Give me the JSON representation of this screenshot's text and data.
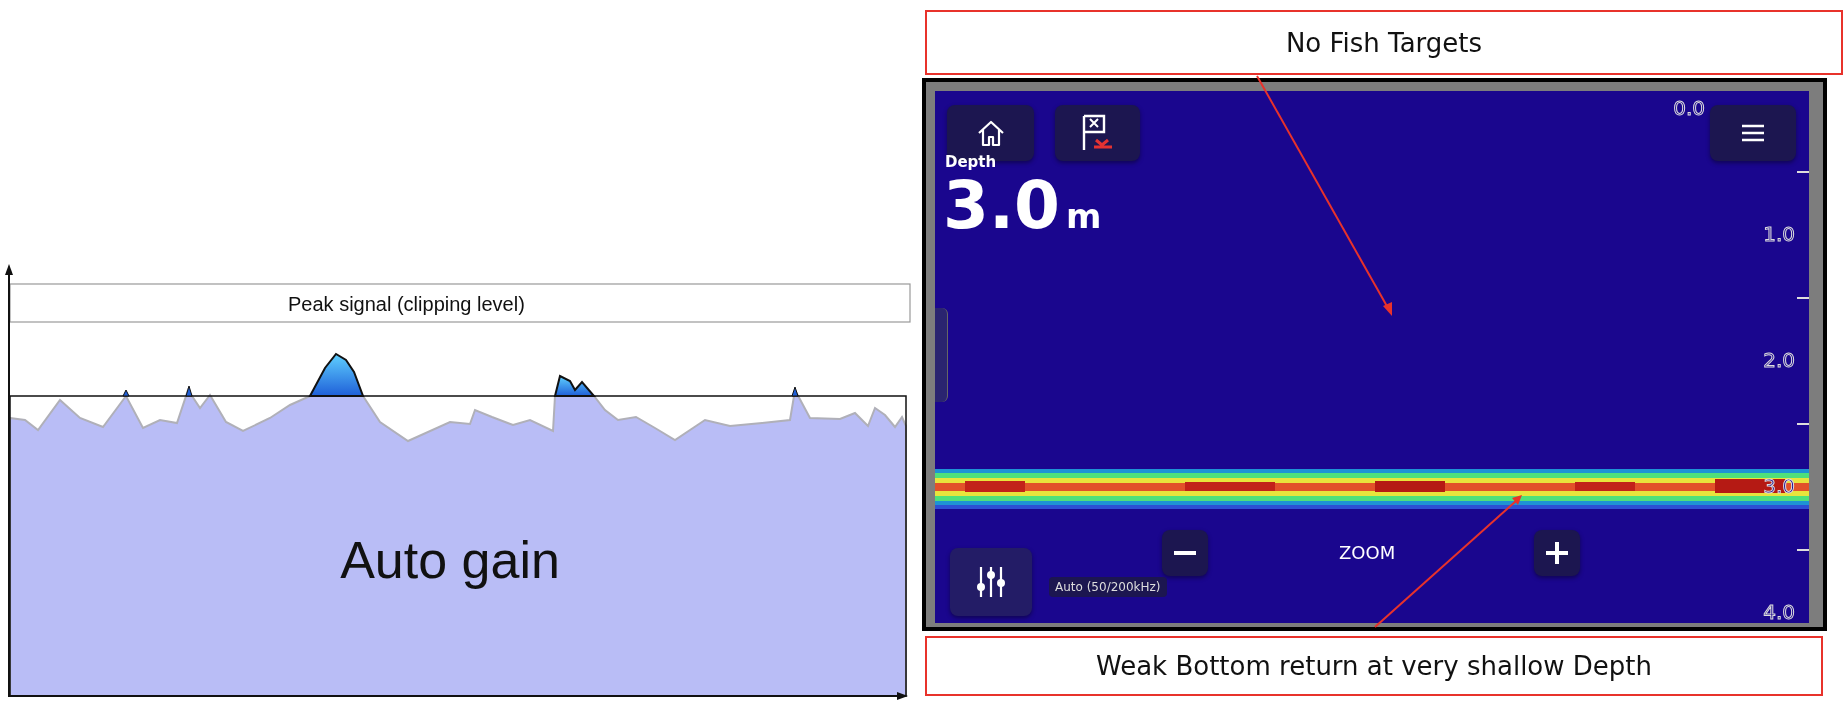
{
  "diagram": {
    "band_label": "Peak signal (clipping level)",
    "area_label": "Auto gain"
  },
  "top_callout": {
    "text": "No Fish Targets"
  },
  "sonar": {
    "depth_label": "Depth",
    "depth_value": "3.0",
    "depth_unit": "m",
    "zoom_label": "ZOOM",
    "frequency": "Auto (50/200kHz)",
    "scale": [
      "0.0",
      "1.0",
      "2.0",
      "3.0",
      "4.0"
    ]
  },
  "bottom_callout": {
    "text": "Weak Bottom return at very shallow Depth"
  }
}
